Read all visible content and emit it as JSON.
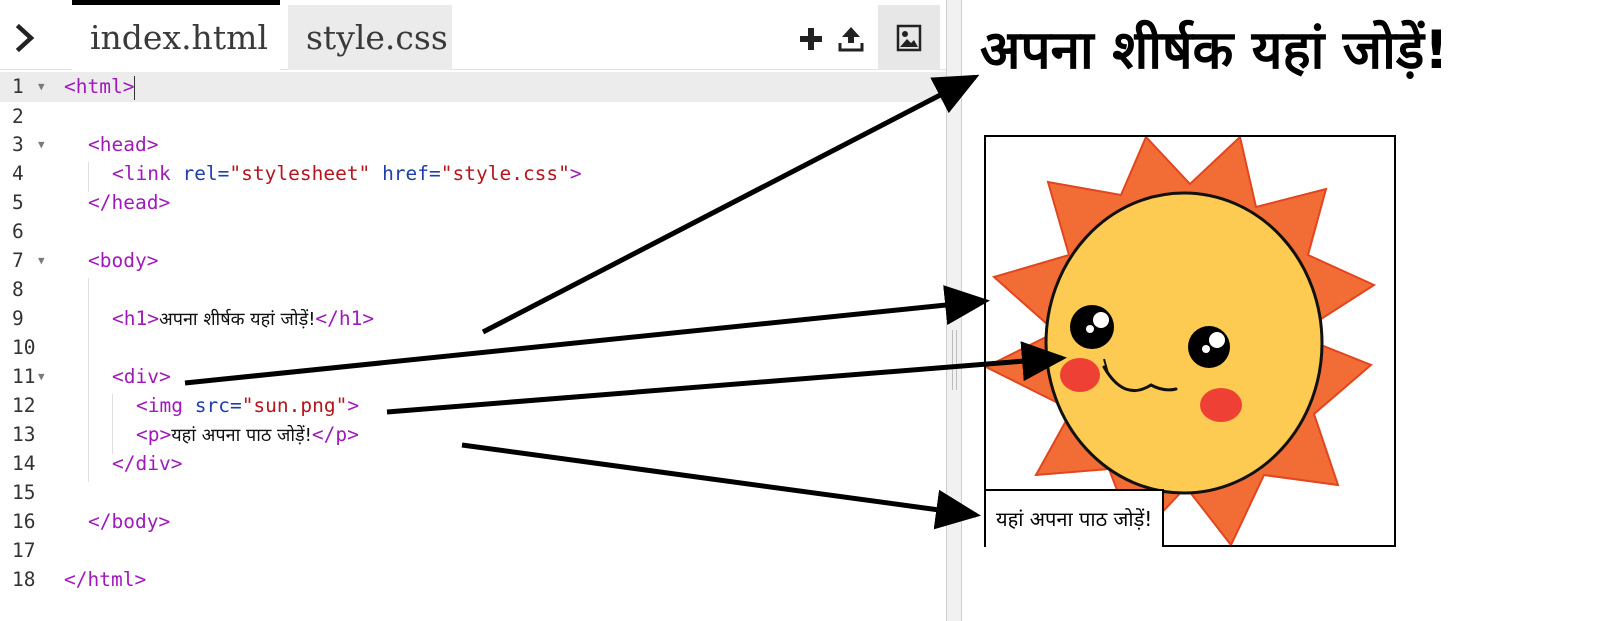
{
  "tabs": [
    {
      "label": "index.html",
      "active": true
    },
    {
      "label": "style.css",
      "active": false
    }
  ],
  "toolbar": {
    "expand_icon": "chevron-right-icon",
    "add_icon": "plus-icon",
    "upload_icon": "upload-icon",
    "image_icon": "image-icon"
  },
  "code_lines": [
    {
      "num": "1",
      "fold": true
    },
    {
      "num": "2",
      "fold": false
    },
    {
      "num": "3",
      "fold": true
    },
    {
      "num": "4",
      "fold": false
    },
    {
      "num": "5",
      "fold": false
    },
    {
      "num": "6",
      "fold": false
    },
    {
      "num": "7",
      "fold": true
    },
    {
      "num": "8",
      "fold": false
    },
    {
      "num": "9",
      "fold": false
    },
    {
      "num": "10",
      "fold": false
    },
    {
      "num": "11",
      "fold": true
    },
    {
      "num": "12",
      "fold": false
    },
    {
      "num": "13",
      "fold": false
    },
    {
      "num": "14",
      "fold": false
    },
    {
      "num": "15",
      "fold": false
    },
    {
      "num": "16",
      "fold": false
    },
    {
      "num": "17",
      "fold": false
    },
    {
      "num": "18",
      "fold": false
    }
  ],
  "code": {
    "l1": {
      "tag": "<html>"
    },
    "l3": {
      "tag": "<head>"
    },
    "l4": {
      "tag_open": "<link",
      "attr1": "rel=",
      "val1": "\"stylesheet\"",
      "attr2": "href=",
      "val2": "\"style.css\"",
      "tag_close": ">"
    },
    "l5": {
      "tag": "</head>"
    },
    "l7": {
      "tag": "<body>"
    },
    "l9": {
      "open": "<h1>",
      "text": "अपना शीर्षक यहां जोड़ें!",
      "close": "</h1>"
    },
    "l11": {
      "tag": "<div>"
    },
    "l12": {
      "tag_open": "<img",
      "attr": "src=",
      "val": "\"sun.png\"",
      "tag_close": ">"
    },
    "l13": {
      "open": "<p>",
      "text": "यहां अपना पाठ जोड़ें!",
      "close": "</p>"
    },
    "l14": {
      "tag": "</div>"
    },
    "l16": {
      "tag": "</body>"
    },
    "l18": {
      "tag": "</html>"
    }
  },
  "preview": {
    "heading": "अपना शीर्षक यहां जोड़ें!",
    "caption": "यहां अपना पाठ जोड़ें!",
    "image_icon": "sun-image"
  },
  "colors": {
    "tag": "#a01abb",
    "attribute": "#1f3fae",
    "string": "#b6151d",
    "sun_rays": "#f26d35",
    "sun_face": "#fdcb52",
    "cheeks": "#ee4035"
  }
}
